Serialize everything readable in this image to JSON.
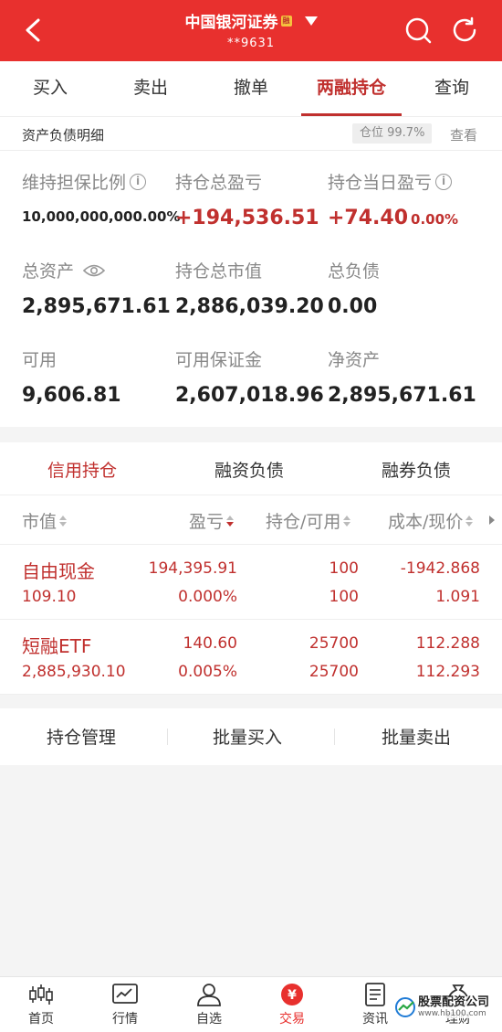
{
  "header": {
    "broker": "中国银河证券",
    "badge": "融",
    "account": "**9631"
  },
  "tabs": [
    "买入",
    "卖出",
    "撤单",
    "两融持仓",
    "查询"
  ],
  "active_tab": "两融持仓",
  "summary": {
    "title": "资产负债明细",
    "position_ratio": "仓位 99.7%",
    "view": "查看"
  },
  "assets": {
    "maintenance_ratio": {
      "label": "维持担保比例",
      "value": "10,000,000,000.00%"
    },
    "total_pnl": {
      "label": "持仓总盈亏",
      "value": "+194,536.51"
    },
    "daily_pnl": {
      "label": "持仓当日盈亏",
      "value": "+74.40",
      "pct": "0.00%"
    },
    "total_assets": {
      "label": "总资产",
      "value": "2,895,671.61"
    },
    "market_value": {
      "label": "持仓总市值",
      "value": "2,886,039.20"
    },
    "total_liab": {
      "label": "总负债",
      "value": "0.00"
    },
    "available": {
      "label": "可用",
      "value": "9,606.81"
    },
    "available_margin": {
      "label": "可用保证金",
      "value": "2,607,018.96"
    },
    "net_assets": {
      "label": "净资产",
      "value": "2,895,671.61"
    }
  },
  "holding_tabs": [
    "信用持仓",
    "融资负债",
    "融券负债"
  ],
  "columns": {
    "c1": "市值",
    "c2": "盈亏",
    "c3": "持仓/可用",
    "c4": "成本/现价"
  },
  "rows": [
    {
      "name": "自由现金",
      "mv": "109.10",
      "pnl": "194,395.91",
      "pnl_pct": "0.000%",
      "hold": "100",
      "avail": "100",
      "cost": "-1942.868",
      "price": "1.091"
    },
    {
      "name": "短融ETF",
      "mv": "2,885,930.10",
      "pnl": "140.60",
      "pnl_pct": "0.005%",
      "hold": "25700",
      "avail": "25700",
      "cost": "112.288",
      "price": "112.293"
    }
  ],
  "actions": [
    "持仓管理",
    "批量买入",
    "批量卖出"
  ],
  "nav": [
    {
      "label": "首页",
      "icon": "candlestick-icon"
    },
    {
      "label": "行情",
      "icon": "chart-icon"
    },
    {
      "label": "自选",
      "icon": "user-icon"
    },
    {
      "label": "交易",
      "icon": "yuan-icon"
    },
    {
      "label": "资讯",
      "icon": "news-icon"
    },
    {
      "label": "理财",
      "icon": "wealth-icon"
    }
  ],
  "watermark": {
    "text": "股票配资公司",
    "sub": "www.hb100.com"
  },
  "colors": {
    "brand": "#e8302e",
    "accent": "#c0302e"
  }
}
